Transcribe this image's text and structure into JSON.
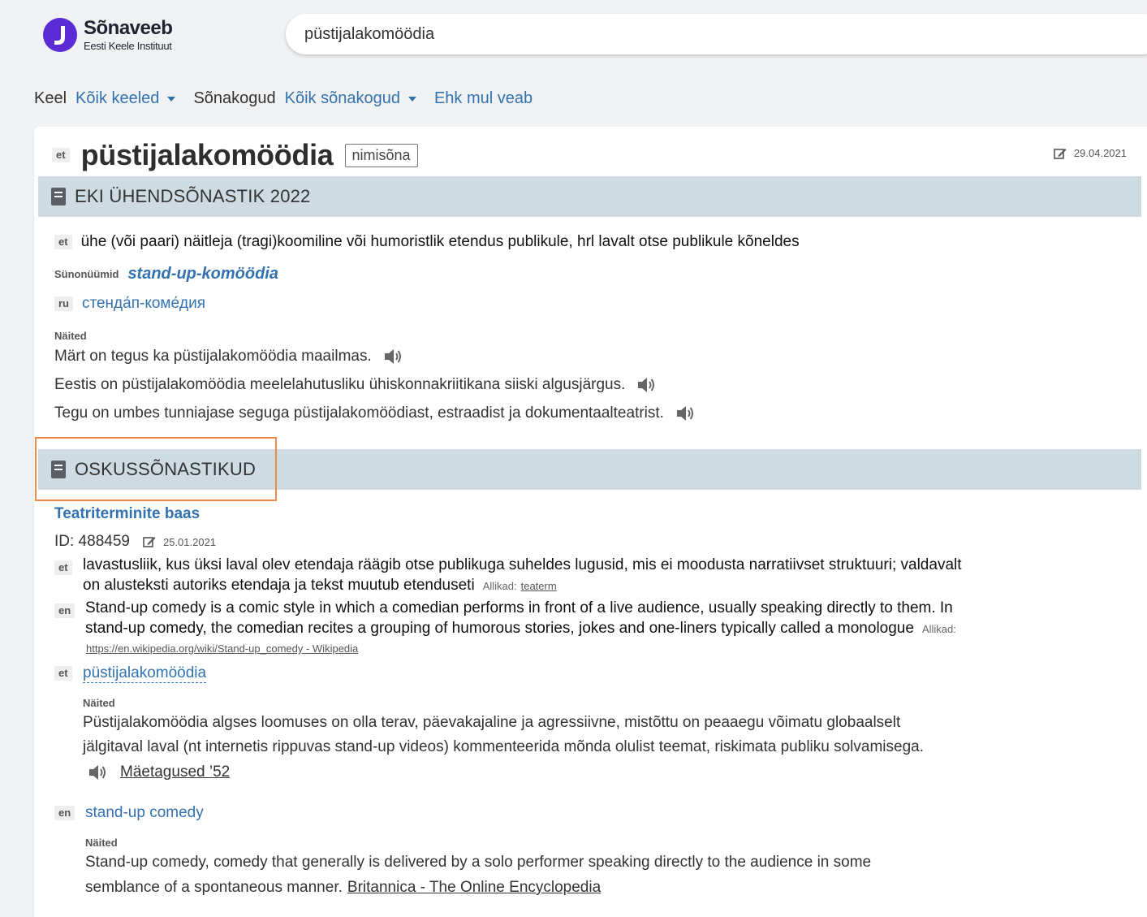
{
  "brand": {
    "title": "Sõnaveeb",
    "subtitle": "Eesti Keele Instituut"
  },
  "search": {
    "value": "püstijalakomöödia"
  },
  "filters": {
    "language_label": "Keel",
    "language_value": "Kõik keeled",
    "collections_label": "Sõnakogud",
    "collections_value": "Kõik sõnakogud",
    "typo_link": "Ehk mul veab"
  },
  "entry": {
    "lang": "et",
    "headword": "püstijalakomöödia",
    "pos": "nimisõna",
    "date": "29.04.2021"
  },
  "section1": {
    "title": "EKI ÜHENDSÕNASTIK 2022",
    "definition_lang": "et",
    "definition": "ühe (või paari) näitleja (tragi)koomiline või humoristlik etendus publikule, hrl lavalt otse publikule kõneldes",
    "synonyms_label": "Sünonüümid",
    "synonym": "stand-up-komöödia",
    "translation_lang": "ru",
    "translation": "стенда́п-коме́дия",
    "examples_label": "Näited",
    "examples": [
      "Märt on tegus ka püstijalakomöödia maailmas.",
      "Eestis on püstijalakomöödia meelelahutusliku ühiskonnakriitikana siiski algusjärgus.",
      "Tegu on umbes tunniajase seguga püstijalakomöödiast, estraadist ja dokumentaalteatrist."
    ]
  },
  "section2": {
    "title": "OSKUSSÕNASTIKUD",
    "dataset": "Teatriterminite baas",
    "id_text": "ID: 488459",
    "date": "25.01.2021",
    "def_et_lang": "et",
    "def_et_line1": "lavastusliik, kus üksi laval olev etendaja räägib otse publikuga suheldes lugusid, mis ei moodusta narratiivset struktuuri; valdavalt",
    "def_et_line2": "on alusteksti autoriks etendaja ja tekst muutub etenduseti",
    "source_label": "Allikad:",
    "def_et_source": "teaterm",
    "def_en_lang": "en",
    "def_en_line1": "Stand-up comedy is a comic style in which a comedian performs in front of a live audience, usually speaking directly to them. In",
    "def_en_line2": "stand-up comedy, the comedian recites a grouping of humorous stories, jokes and one-liners typically called a monologue",
    "def_en_source": "https://en.wikipedia.org/wiki/Stand-up_comedy - Wikipedia",
    "term_et_lang": "et",
    "term_et": "püstijalakomöödia",
    "examples_label": "Näited",
    "term_et_example_line1": "Püstijalakomöödia algses loomuses on olla terav, päevakajaline ja agressiivne, mistõttu on peaaegu võimatu globaalselt",
    "term_et_example_line2": "jälgitaval laval (nt internetis rippuvas stand-up videos) kommenteerida mõnda olulist teemat, riskimata publiku solvamisega.",
    "term_et_example_source": "Mäetagused ’52",
    "term_en_lang": "en",
    "term_en": "stand-up comedy",
    "term_en_example_line1": "Stand-up comedy, comedy that generally is delivered by a solo performer speaking directly to the audience in some",
    "term_en_example_line2": "semblance of a spontaneous manner.",
    "term_en_example_source": "Britannica - The Online Encyclopedia"
  },
  "colors": {
    "accent": "#3372b0",
    "brand": "#5b2bd6",
    "section_bar": "#cfdbe3",
    "highlight": "#ee8a45"
  },
  "icons": [
    "logo-icon",
    "edit-icon",
    "book-icon",
    "speaker-icon",
    "caret-down-icon"
  ]
}
